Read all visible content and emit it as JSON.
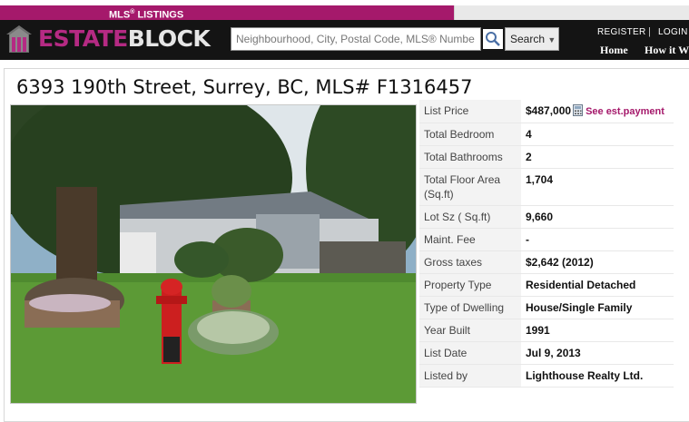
{
  "header": {
    "mls_tab": "MLS",
    "mls_tab_reg": "®",
    "mls_tab_suffix": " LISTINGS",
    "logo_estate": "ESTATE",
    "logo_block": "BLOCK",
    "search_placeholder": "Neighbourhood, City, Postal Code, MLS® Numbe",
    "search_button": "Search",
    "search_caret": "▼",
    "register": "REGISTER",
    "separator": "|",
    "login": "LOGIN",
    "nav": [
      "Home",
      "How it W"
    ]
  },
  "listing": {
    "title": "6393 190th Street, Surrey, BC, MLS# F1316457",
    "price_label": "List Price",
    "price": "$487,000",
    "payment_link": "See est.payment",
    "details": [
      {
        "label": "Total Bedroom",
        "value": "4"
      },
      {
        "label": "Total Bathrooms",
        "value": "2"
      },
      {
        "label": "Total Floor Area (Sq.ft)",
        "value": "1,704"
      },
      {
        "label": "Lot Sz ( Sq.ft)",
        "value": "9,660"
      },
      {
        "label": "Maint. Fee",
        "value": "-"
      },
      {
        "label": "Gross taxes",
        "value": "$2,642 (2012)"
      },
      {
        "label": "Property Type",
        "value": "Residential Detached"
      },
      {
        "label": "Type of Dwelling",
        "value": "House/Single Family"
      },
      {
        "label": "Year Built",
        "value": "1991"
      },
      {
        "label": "List Date",
        "value": "Jul 9, 2013"
      },
      {
        "label": "Listed by",
        "value": "Lighthouse Realty Ltd."
      }
    ]
  },
  "colors": {
    "brand": "#a5196b",
    "header_bg": "#141414"
  },
  "icons": [
    "house-logo-icon",
    "magnifier-icon",
    "calculator-icon"
  ]
}
